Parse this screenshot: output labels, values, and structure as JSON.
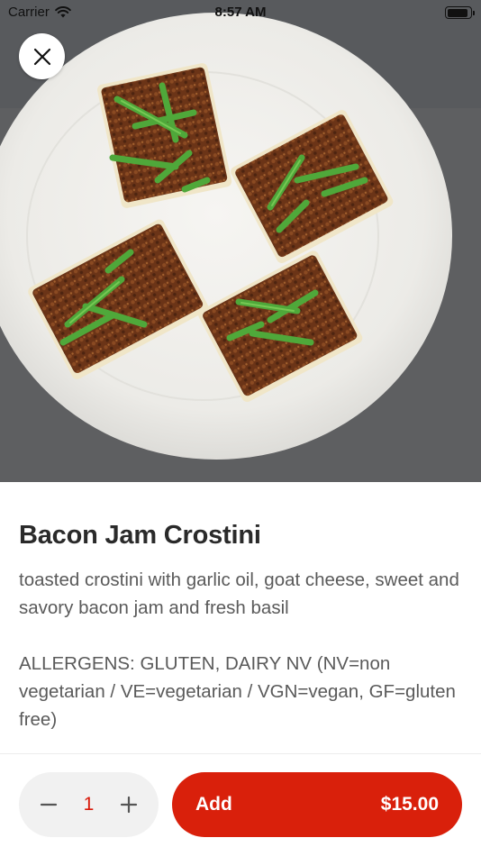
{
  "status_bar": {
    "carrier": "Carrier",
    "time": "8:57 AM",
    "battery_level": 0.9
  },
  "hero": {
    "icon": "food-photo"
  },
  "close": {
    "icon": "close-icon"
  },
  "item": {
    "title": "Bacon Jam Crostini",
    "description": "toasted crostini with garlic oil, goat cheese, sweet and savory bacon jam and fresh basil",
    "allergens": "ALLERGENS: GLUTEN, DAIRY NV  (NV=non vegetarian / VE=vegetarian / VGN=vegan, GF=gluten free)"
  },
  "cart": {
    "quantity": "1",
    "add_label": "Add",
    "price": "$15.00"
  },
  "colors": {
    "accent": "#d9200b",
    "stepper_bg": "#f1f1f1",
    "quantity_text": "#d91a0a"
  }
}
